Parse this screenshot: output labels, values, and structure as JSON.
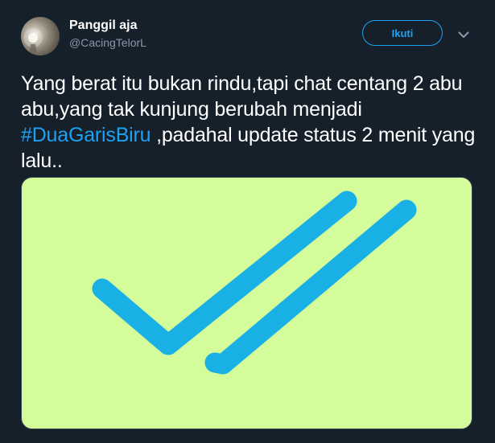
{
  "user": {
    "display_name": "Panggil aja",
    "handle": "@CacingTelorL"
  },
  "follow_button": {
    "label": "Ikuti"
  },
  "tweet": {
    "text_before_hashtag": "Yang berat itu bukan rindu,tapi chat centang 2 abu abu,yang tak kunjung berubah menjadi ",
    "hashtag": "#DuaGarisBiru",
    "text_after_hashtag": " ,padahal update status 2 menit yang lalu.."
  },
  "media": {
    "background_color": "#d4fc9a",
    "checkmark_color": "#19b0e6",
    "icon": "double-checkmark-icon"
  },
  "colors": {
    "background": "#15202b",
    "accent": "#1da1f2",
    "secondary_text": "#8899a6"
  }
}
